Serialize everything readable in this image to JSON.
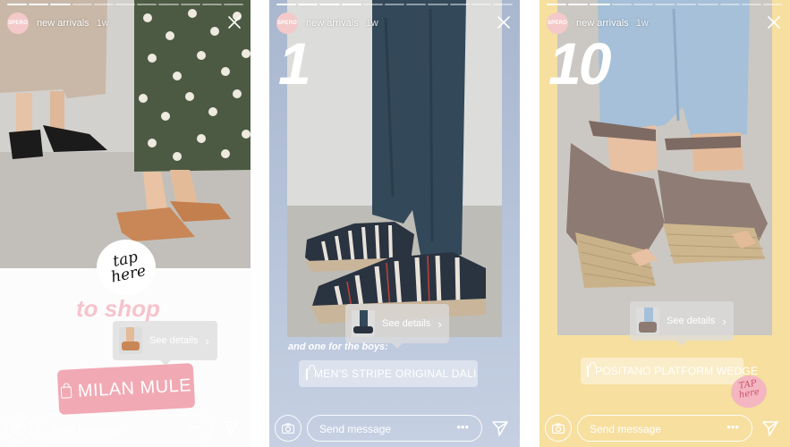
{
  "story_header": {
    "avatar_text": "SPERO",
    "username": "new arrivals",
    "time": "1w"
  },
  "stories": [
    {
      "id": "milan-mule",
      "tap_text": "tap here",
      "cta": "to shop",
      "details_label": "See details",
      "product_name": "MILAN MULE",
      "progress_done": 3,
      "progress_total": 11
    },
    {
      "id": "mens-stripe",
      "big_number": "1",
      "caption": "and one for the boys:",
      "details_label": "See details",
      "product_name": "MEN'S STRIPE ORIGINAL DALI",
      "progress_done": 4,
      "progress_total": 11
    },
    {
      "id": "positano",
      "big_number": "10",
      "details_label": "See details",
      "product_name": "POSITANO PLATFORM WEDGE",
      "tap_text": "TAP here",
      "progress_done": 3,
      "progress_total": 11
    }
  ],
  "composer": {
    "placeholder": "Send message",
    "more": "•••"
  },
  "icons": {
    "close": "close-icon",
    "camera": "camera-icon",
    "send": "send-icon",
    "shopping_bag": "shopping-bag-icon",
    "chevron": "chevron-right-icon"
  },
  "colors": {
    "pink_accent": "#f4b6c0",
    "story2_bg": "#b2bfd6",
    "story3_bg": "#f6df9f"
  }
}
